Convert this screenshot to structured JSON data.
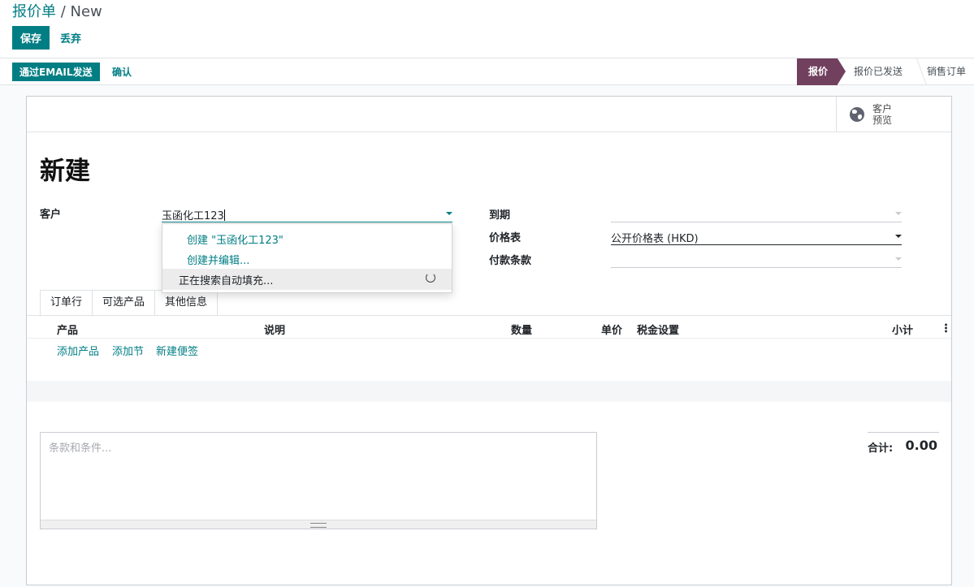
{
  "breadcrumb": {
    "parent": "报价单",
    "separator": " / ",
    "current": "New"
  },
  "toolbar": {
    "save_label": "保存",
    "discard_label": "丢弃"
  },
  "statusbar": {
    "email_label": "通过EMAIL发送",
    "confirm_label": "确认",
    "stages": [
      "报价",
      "报价已发送",
      "销售订单"
    ],
    "current_stage": "报价"
  },
  "button_box": {
    "preview_label_1": "客户",
    "preview_label_2": "预览",
    "icon": "globe-icon"
  },
  "form": {
    "title": "新建",
    "customer_label": "客户",
    "customer_value": "玉函化工123",
    "expiration_label": "到期",
    "expiration_value": "",
    "pricelist_label": "价格表",
    "pricelist_value": "公开价格表 (HKD)",
    "payment_terms_label": "付款条款",
    "payment_terms_value": ""
  },
  "autocomplete": {
    "create_label": "创建 \"玉函化工123\"",
    "create_edit_label": "创建并编辑...",
    "searching_label": "正在搜索自动填充..."
  },
  "tabs": [
    "订单行",
    "可选产品",
    "其他信息"
  ],
  "order_lines": {
    "columns": [
      "产品",
      "说明",
      "数量",
      "单价",
      "税金设置",
      "小计"
    ],
    "add_product": "添加产品",
    "add_section": "添加节",
    "add_note": "新建便签"
  },
  "notes": {
    "placeholder": "条款和条件..."
  },
  "totals": {
    "total_label": "合计:",
    "total_value": "0.00"
  },
  "colors": {
    "primary": "#017e84",
    "stage_active": "#71405e"
  }
}
